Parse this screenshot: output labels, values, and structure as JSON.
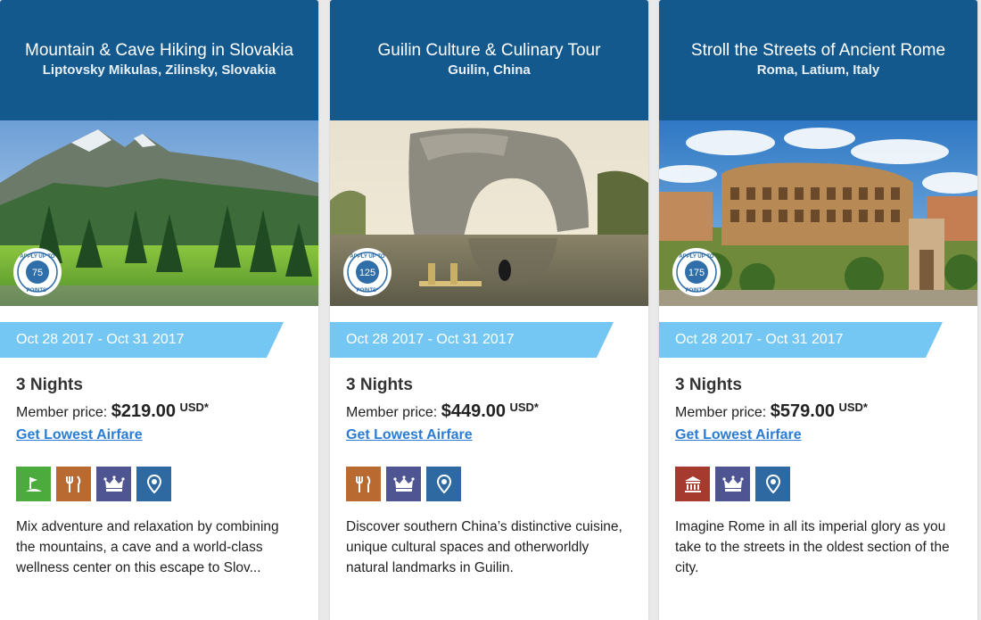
{
  "cards": [
    {
      "title": "Mountain & Cave Hiking in Slovakia",
      "location": "Liptovsky Mikulas, Zilinsky, Slovakia",
      "badge": {
        "top_text": "APPLY UP TO",
        "points": "75",
        "bottom_text": "POINTS*"
      },
      "dates": "Oct 28 2017 - Oct 31 2017",
      "nights": "3 Nights",
      "price_label": "Member price:",
      "price": "$219.00",
      "currency": "USD*",
      "airfare_link": "Get Lowest Airfare",
      "amenities": [
        "golf-icon",
        "dining-icon",
        "luxury-crown-icon",
        "location-pin-icon"
      ],
      "description": "Mix adventure and relaxation by combining the mountains, a cave and a world-class wellness center on this escape to Slov..."
    },
    {
      "title": "Guilin Culture & Culinary Tour",
      "location": "Guilin, China",
      "badge": {
        "top_text": "APPLY UP TO",
        "points": "125",
        "bottom_text": "POINTS*"
      },
      "dates": "Oct 28 2017 - Oct 31 2017",
      "nights": "3 Nights",
      "price_label": "Member price:",
      "price": "$449.00",
      "currency": "USD*",
      "airfare_link": "Get Lowest Airfare",
      "amenities": [
        "dining-icon",
        "luxury-crown-icon",
        "location-pin-icon"
      ],
      "description": "Discover southern China’s distinctive cuisine, unique cultural spaces and otherworldly natural landmarks in Guilin."
    },
    {
      "title": "Stroll the Streets of Ancient Rome",
      "location": "Roma, Latium, Italy",
      "badge": {
        "top_text": "APPLY UP TO",
        "points": "175",
        "bottom_text": "POINTS*"
      },
      "dates": "Oct 28 2017 - Oct 31 2017",
      "nights": "3 Nights",
      "price_label": "Member price:",
      "price": "$579.00",
      "currency": "USD*",
      "airfare_link": "Get Lowest Airfare",
      "amenities": [
        "museum-icon",
        "luxury-crown-icon",
        "location-pin-icon"
      ],
      "description": "Imagine Rome in all its imperial glory as you take to the streets in the oldest section of the city."
    }
  ],
  "colors": {
    "header": "#14598e",
    "date_banner": "#74c7f3",
    "link": "#2a7cd4",
    "golf": "#4bab3c",
    "dining": "#b86a30",
    "luxury": "#4f5592",
    "location": "#2e69a1",
    "museum": "#a63a2e"
  }
}
